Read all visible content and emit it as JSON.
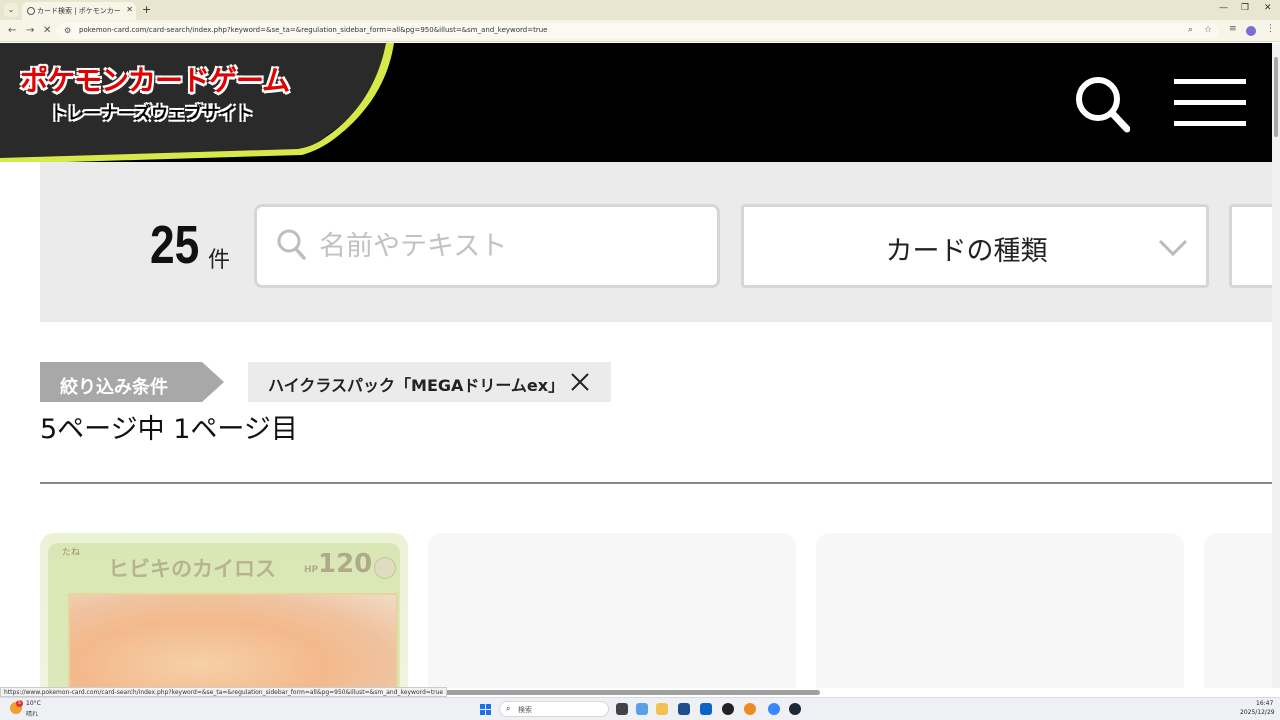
{
  "browser": {
    "tab_title": "カード検索 | ポケモンカードゲーム公...",
    "url": "pokemon-card.com/card-search/index.php?keyword=&se_ta=&regulation_sidebar_form=all&pg=950&illust=&sm_and_keyword=true",
    "status_url": "https://www.pokemon-card.com/card-search/index.php?keyword=&se_ta=&regulation_sidebar_form=all&pg=950&illust=&sm_and_keyword=true",
    "tab_dropdown_glyph": "⌄",
    "tab_close_glyph": "✕",
    "new_tab_glyph": "+",
    "win_minimize_glyph": "—",
    "win_restore_glyph": "❐",
    "win_close_glyph": "✕",
    "back_glyph": "←",
    "forward_glyph": "→",
    "reload_glyph": "✕",
    "site_info_glyph": "⚙",
    "zoom_glyph": "⌕",
    "bookmark_glyph": "☆",
    "extension_glyph": "≡",
    "more_glyph": "⋮"
  },
  "site": {
    "logo_main": "ポケモンカードゲーム",
    "logo_sub": "トレーナーズウェブサイト"
  },
  "search": {
    "count": "25",
    "count_unit": "件",
    "placeholder": "名前やテキスト",
    "card_type_label": "カードの種類"
  },
  "filter": {
    "label": "絞り込み条件",
    "chip": "ハイクラスパック「MEGAドリームex」"
  },
  "pagination": {
    "info": "5ページ中 1ページ目"
  },
  "cards": [
    {
      "stage": "たね",
      "name": "ヒビキのカイロス",
      "hp_label": "HP",
      "hp": "120",
      "type_icon": "grass-energy-icon"
    }
  ],
  "taskbar": {
    "temperature": "10°C",
    "condition": "晴れ",
    "weather_badge": "5",
    "search_placeholder": "検索",
    "search_glyph": "⌕",
    "time": "16:47",
    "date": "2025/12/29"
  },
  "colors": {
    "header_bg": "#000000",
    "logo_red": "#e30000",
    "accent_yellow": "#d6e84a",
    "filter_band": "#ebebeb",
    "filter_label_bg": "#a8a8a8"
  }
}
